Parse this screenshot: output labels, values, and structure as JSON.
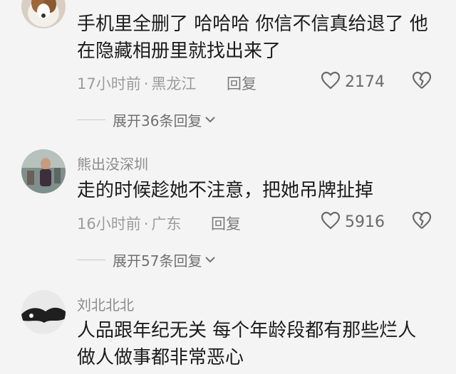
{
  "comments": [
    {
      "username": "",
      "text_lines": [
        "手机里全删了 哈哈哈 你信不信真给退了 他",
        "在隐藏相册里就找出来了"
      ],
      "time": "17小时前",
      "location": "黑龙江",
      "reply_label": "回复",
      "like_count": "2174",
      "expand_label": "展开36条回复"
    },
    {
      "username": "熊出没深圳",
      "text_lines": [
        "走的时候趁她不注意，把她吊牌扯掉"
      ],
      "time": "16小时前",
      "location": "广东",
      "reply_label": "回复",
      "like_count": "5916",
      "expand_label": "展开57条回复"
    },
    {
      "username": "刘北北北",
      "text_lines": [
        "人品跟年纪无关 每个年龄段都有那些烂人",
        "做人做事都非常恶心"
      ]
    }
  ],
  "separator": "·",
  "icons": {
    "like": "heart-outline-icon",
    "dislike": "broken-heart-icon",
    "expand": "chevron-down-icon"
  },
  "colors": {
    "background": "#f4f4f4",
    "text": "#1c1c1c",
    "secondary": "#9c9c9c"
  }
}
